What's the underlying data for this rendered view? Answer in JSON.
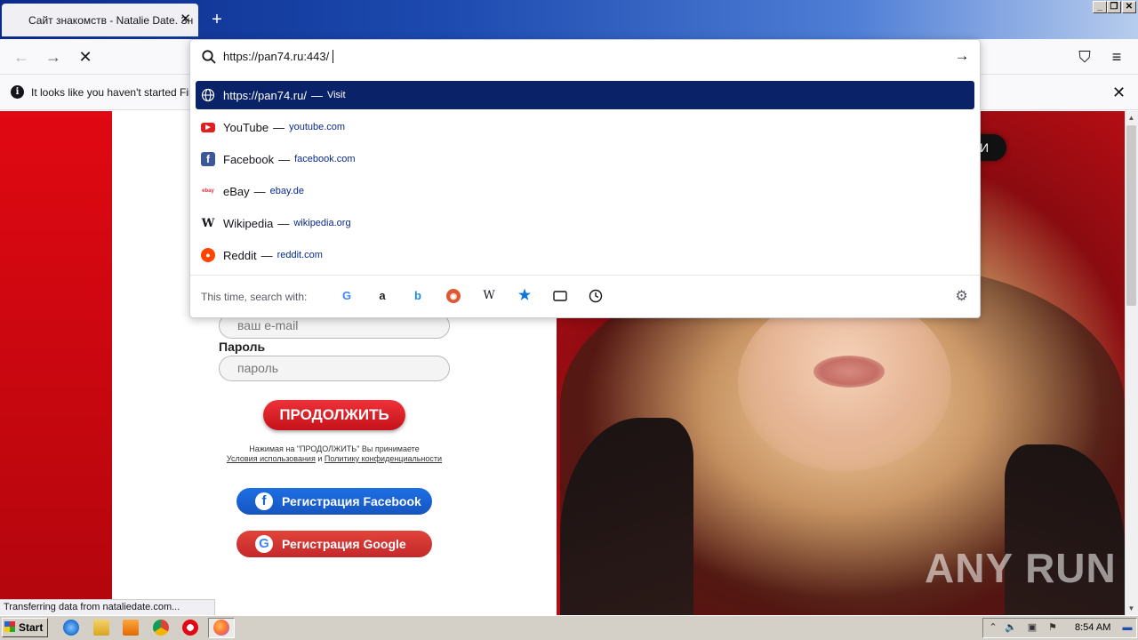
{
  "browser": {
    "tab_title": "Сайт знакомств - Natalie Date. Зн",
    "tab_close": "✕",
    "new_tab": "+",
    "window_buttons": {
      "minimize": "_",
      "restore": "❐",
      "close": "✕"
    },
    "nav": {
      "back": "←",
      "forward": "→",
      "stop": "✕",
      "pocket": "⛉",
      "menu": "≡"
    }
  },
  "notification": {
    "icon": "i",
    "text": "It looks like you haven't started Firefo",
    "close": "✕"
  },
  "urlbar": {
    "value": "https://pan74.ru:443/",
    "go": "→",
    "results": [
      {
        "title": "https://pan74.ru/",
        "sub": "Visit",
        "icon": "globe-icon",
        "selected": true
      },
      {
        "title": "YouTube",
        "sub": "youtube.com",
        "icon": "youtube-icon",
        "selected": false
      },
      {
        "title": "Facebook",
        "sub": "facebook.com",
        "icon": "facebook-icon",
        "selected": false
      },
      {
        "title": "eBay",
        "sub": "ebay.de",
        "icon": "ebay-icon",
        "selected": false
      },
      {
        "title": "Wikipedia",
        "sub": "wikipedia.org",
        "icon": "wikipedia-icon",
        "selected": false
      },
      {
        "title": "Reddit",
        "sub": "reddit.com",
        "icon": "reddit-icon",
        "selected": false
      }
    ],
    "dash": "—",
    "search_with_label": "This time, search with:",
    "engines": [
      "google-icon",
      "amazon-icon",
      "bing-icon",
      "duckduckgo-icon",
      "wikipedia-icon",
      "bookmarks-icon",
      "tabs-icon",
      "history-icon"
    ],
    "settings_icon": "gear-icon"
  },
  "page": {
    "email_placeholder": "ваш e-mail",
    "password_label": "Пароль",
    "password_placeholder": "пароль",
    "continue_label": "ПРОДОЛЖИТЬ",
    "terms_line1": "Нажимая на \"ПРОДОЛЖИТЬ\" Вы принимаете",
    "terms_link1": "Условия использования",
    "terms_and": "и",
    "terms_link2": "Политику конфиденциальности",
    "facebook_label": "Регистрация Facebook",
    "google_label": "Регистрация Google",
    "dark_button_fragment": "И"
  },
  "status_text": "Transferring data from nataliedate.com...",
  "watermark": "ANY RUN",
  "taskbar": {
    "start_label": "Start",
    "clock": "8:54 AM"
  },
  "colors": {
    "selected_row": "#0a2268",
    "page_red": "#c30f15",
    "continue_red": "#d81e25",
    "facebook_blue": "#1a62d6",
    "google_red": "#d63431"
  }
}
